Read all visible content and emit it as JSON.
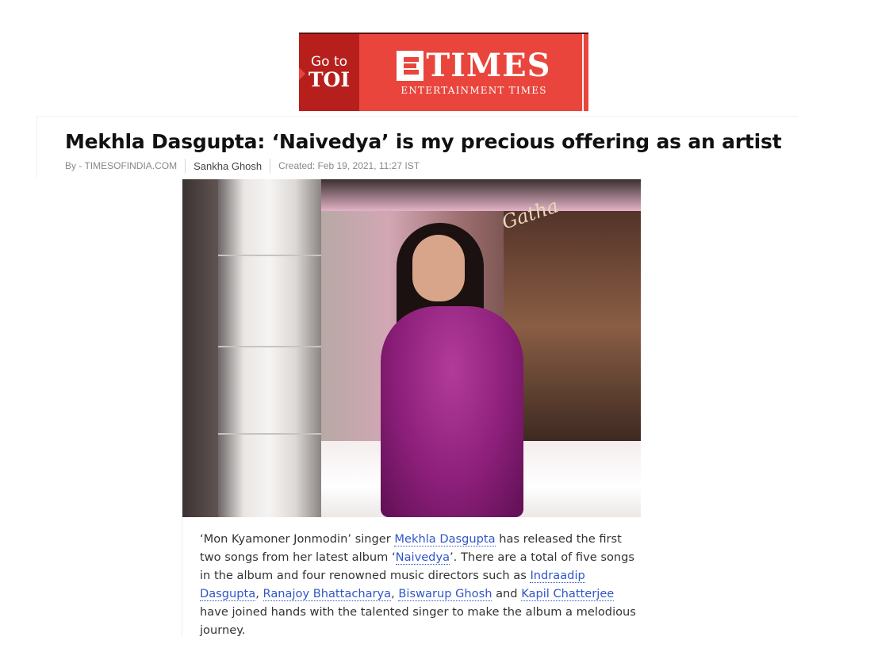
{
  "banner": {
    "goto_small": "Go to",
    "goto_big": "TOI",
    "brand": "TIMES",
    "brand_sub": "ENTERTAINMENT TIMES",
    "colors": {
      "bg": "#e9453c",
      "goto_bg": "#b71f1c"
    }
  },
  "article": {
    "headline": "Mekhla Dasgupta: ‘Naivedya’ is my precious offering as an artist",
    "byline": "By - TIMESOFINDIA.COM",
    "author": "Sankha Ghosh",
    "created": "Created: Feb 19, 2021, 11:27 IST",
    "photo_icon": "woman-in-purple-saree-photo",
    "paragraph": {
      "t1": "‘Mon Kyamoner Jonmodin’ singer ",
      "link1": "Mekhla Dasgupta",
      "t2": " has released the first two songs from her latest album ‘",
      "link2": "Naivedya",
      "t3": "’. There are a total of five songs in the album and four renowned music directors such as ",
      "link3": "Indraadip Dasgupta",
      "t4": ", ",
      "link4": "Ranajoy Bhattacharya",
      "t5": ", ",
      "link5": "Biswarup Ghosh",
      "t6": " and ",
      "link6": "Kapil Chatterjee",
      "t7": " have joined hands with the talented singer to make the album a melodious journey."
    }
  },
  "colors": {
    "link": "#2f56c8",
    "headline": "#111111"
  }
}
